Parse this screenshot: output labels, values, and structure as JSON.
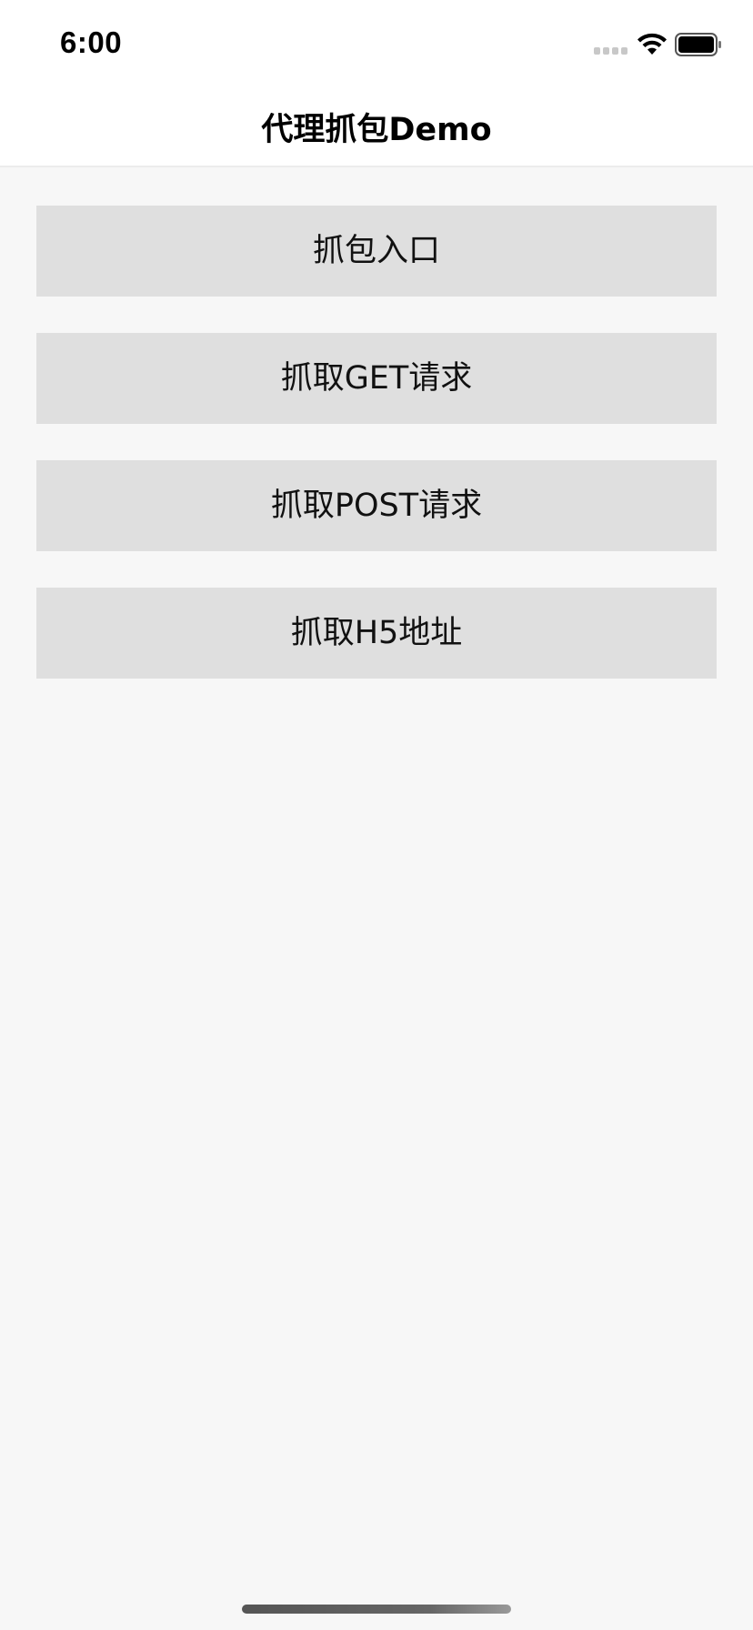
{
  "status_bar": {
    "time": "6:00",
    "signal_icon": "cellular-signal-icon",
    "wifi_icon": "wifi-icon",
    "battery_icon": "battery-icon",
    "battery_level": 1.0
  },
  "nav": {
    "title": "代理抓包Demo"
  },
  "buttons": [
    {
      "label": "抓包入口"
    },
    {
      "label": "抓取GET请求"
    },
    {
      "label": "抓取POST请求"
    },
    {
      "label": "抓取H5地址"
    }
  ],
  "colors": {
    "background": "#f7f7f7",
    "nav_background": "#ffffff",
    "button_background": "#dfdfdf",
    "text": "#111111"
  }
}
